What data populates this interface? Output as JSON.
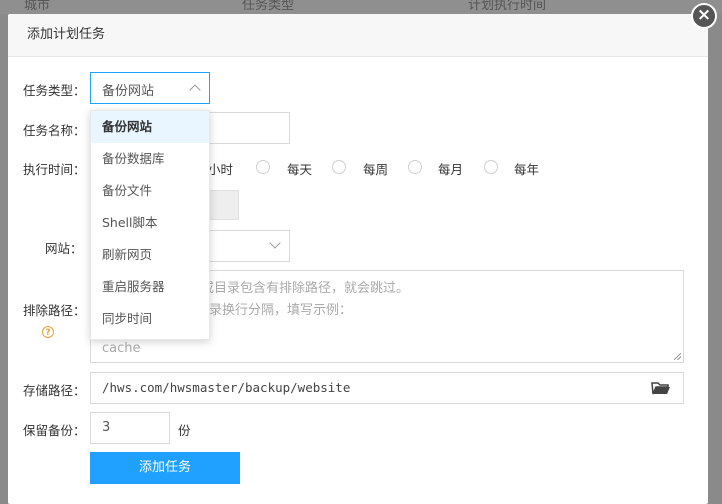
{
  "background_header": {
    "col1": "城市",
    "col2": "任务类型",
    "col3": "计划执行时间"
  },
  "dialog": {
    "title": "添加计划任务",
    "close_label": "×"
  },
  "form": {
    "task_type_label": "任务类型：",
    "task_type_value": "备份网站",
    "task_name_label": "任务名称：",
    "exec_time_label": "执行时间：",
    "time_options": [
      "小时",
      "每天",
      "每周",
      "每月",
      "每年"
    ],
    "website_label": "网站：",
    "exclude_label": "排除路径：",
    "exclude_placeholder_lines": [
      "或目录包含有排除路径，就会跳过。",
      "录换行分隔，填写示例：",
      "cache"
    ],
    "storage_label": "存储路径：",
    "storage_value": "/hws.com/hwsmaster/backup/website",
    "keep_label": "保留备份：",
    "keep_value": "3",
    "keep_unit": "份",
    "submit_label": "添加任务"
  },
  "dropdown": {
    "options": [
      "备份网站",
      "备份数据库",
      "备份文件",
      "Shell脚本",
      "刷新网页",
      "重启服务器",
      "同步时间"
    ],
    "selected_index": 0
  },
  "colors": {
    "accent": "#20a0ff",
    "help": "#e6a23c"
  }
}
